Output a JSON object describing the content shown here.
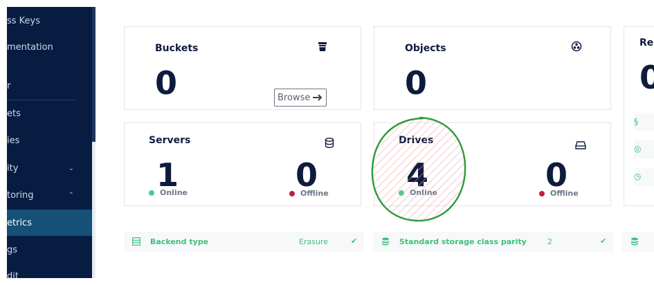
{
  "sidebar": {
    "items": [
      {
        "label": "ss Keys",
        "chevron": ""
      },
      {
        "label": "mentation",
        "chevron": ""
      },
      {
        "label": "r",
        "chevron": ""
      },
      {
        "label": "ets",
        "chevron": ""
      },
      {
        "label": "ies",
        "chevron": ""
      },
      {
        "label": "ity",
        "chevron": "⌄"
      },
      {
        "label": "toring",
        "chevron": "⌃"
      },
      {
        "label": "etrics",
        "chevron": ""
      },
      {
        "label": "gs",
        "chevron": ""
      },
      {
        "label": "dit",
        "chevron": ""
      }
    ],
    "active_index": 7
  },
  "cards": {
    "buckets": {
      "title": "Buckets",
      "value": "0",
      "icon": "bucket-icon",
      "action": "Browse"
    },
    "objects": {
      "title": "Objects",
      "value": "0",
      "icon": "objects-icon"
    },
    "third": {
      "title": "Re",
      "value": "0"
    },
    "servers": {
      "title": "Servers",
      "online_value": "1",
      "online_label": "Online",
      "offline_value": "0",
      "offline_label": "Offline",
      "icon": "database-icon"
    },
    "drives": {
      "title": "Drives",
      "online_value": "4",
      "online_label": "Online",
      "offline_value": "0",
      "offline_label": "Offline",
      "icon": "drive-icon"
    }
  },
  "info_rows": [
    {
      "label": "Backend type",
      "value": "Erasure",
      "icon": "list-icon"
    },
    {
      "label": "Standard storage class parity",
      "value": "2",
      "icon": "database-icon"
    },
    {
      "label": "",
      "value": "",
      "icon": "database-icon"
    }
  ],
  "colors": {
    "sidebar_bg": "#081c42",
    "active_item": "#155077",
    "online": "#4ccb8d",
    "offline": "#c41e3f",
    "accent_green": "#3fbf7f",
    "title_text": "#0f1b3d",
    "annotation_circle": "#2c9a3a",
    "annotation_hatch": "#f2a0a6"
  }
}
